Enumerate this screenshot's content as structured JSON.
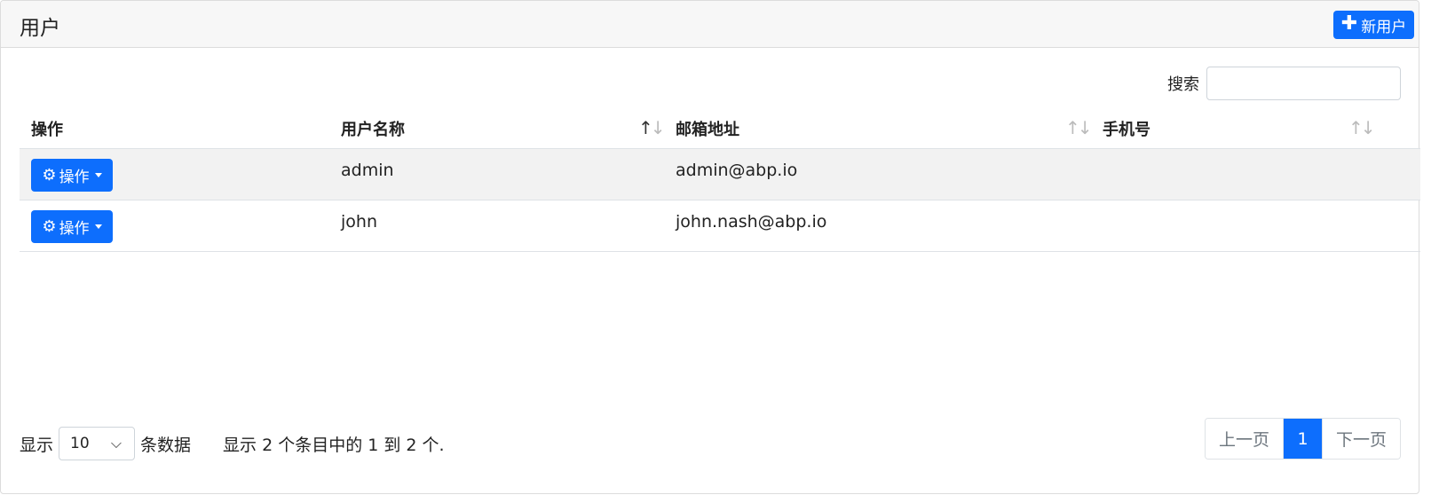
{
  "header": {
    "title": "用户",
    "new_user_label": "新用户",
    "new_user_icon": "plus-icon"
  },
  "search": {
    "label": "搜索",
    "value": "",
    "placeholder": ""
  },
  "table": {
    "columns": [
      {
        "label": "操作",
        "sortable": false
      },
      {
        "label": "用户名称",
        "sortable": true,
        "sort": "asc"
      },
      {
        "label": "邮箱地址",
        "sortable": true,
        "sort": "none"
      },
      {
        "label": "手机号",
        "sortable": true,
        "sort": "none"
      }
    ],
    "action_label": "操作",
    "action_icon": "gear-icon",
    "rows": [
      {
        "username": "admin",
        "email": "admin@abp.io",
        "phone": ""
      },
      {
        "username": "john",
        "email": "john.nash@abp.io",
        "phone": ""
      }
    ]
  },
  "footer": {
    "show_label": "显示",
    "page_size": "10",
    "entries_label": "条数据",
    "info": "显示 2 个条目中的 1 到 2 个."
  },
  "pagination": {
    "prev_label": "上一页",
    "current_page": "1",
    "next_label": "下一页"
  },
  "colors": {
    "primary": "#0d6efd",
    "stripe": "#f2f2f2",
    "header_bg": "#f7f7f7"
  }
}
